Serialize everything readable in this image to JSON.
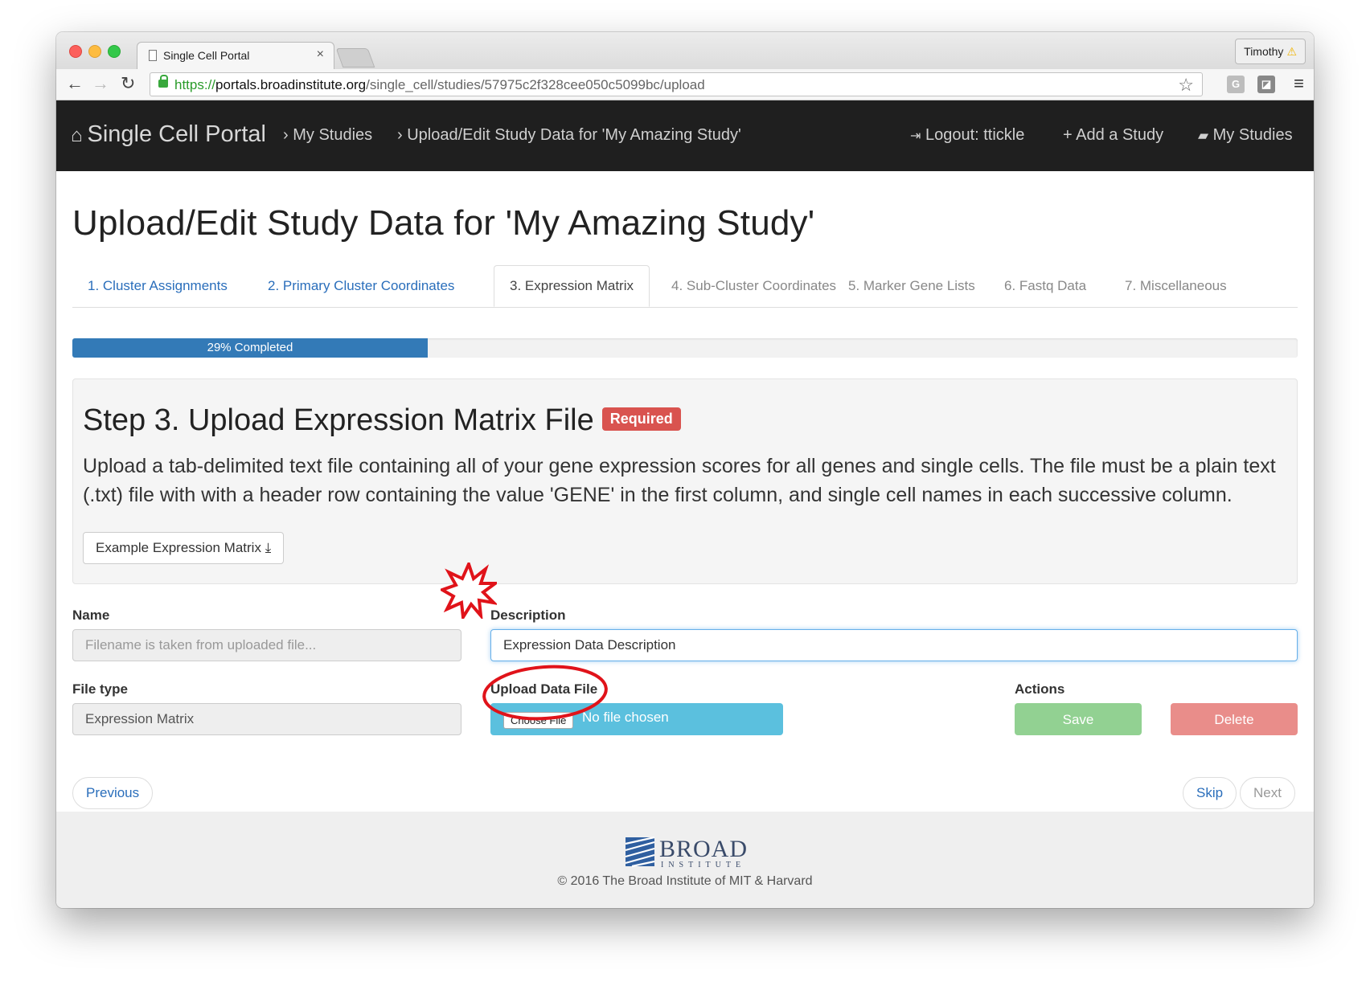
{
  "browser": {
    "tab_title": "Single Cell Portal",
    "tab_close": "×",
    "profile_name": "Timothy",
    "url_scheme": "https://",
    "url_domain": "portals.broadinstitute.org",
    "url_path": "/single_cell/studies/57975c2f328cee050c5099bc/upload"
  },
  "navbar": {
    "brand": "Single Cell Portal",
    "crumb_my_studies": "My Studies",
    "crumb_upload": "Upload/Edit Study Data for 'My Amazing Study'",
    "logout": "Logout: ttickle",
    "add_study": "Add a Study",
    "my_studies": "My Studies"
  },
  "page": {
    "title": "Upload/Edit Study Data for 'My Amazing Study'",
    "tabs": [
      {
        "label": "1. Cluster Assignments",
        "state": "link"
      },
      {
        "label": "2. Primary Cluster Coordinates",
        "state": "link"
      },
      {
        "label": "3. Expression Matrix",
        "state": "active"
      },
      {
        "label": "4. Sub-Cluster Coordinates",
        "state": "disabled"
      },
      {
        "label": "5. Marker Gene Lists",
        "state": "disabled"
      },
      {
        "label": "6. Fastq Data",
        "state": "disabled"
      },
      {
        "label": "7. Miscellaneous",
        "state": "disabled"
      }
    ],
    "progress_percent": 29,
    "progress_label": "29% Completed"
  },
  "step": {
    "heading": "Step 3. Upload Expression Matrix File",
    "badge": "Required",
    "description": "Upload a tab-delimited text file containing all of your gene expression scores for all genes and single cells. The file must be a plain text (.txt) file with with a header row containing the value 'GENE' in the first column, and single cell names in each successive column.",
    "example_button": "Example Expression Matrix"
  },
  "form": {
    "name_label": "Name",
    "name_placeholder": "Filename is taken from uploaded file...",
    "description_label": "Description",
    "description_value": "Expression Data Description",
    "filetype_label": "File type",
    "filetype_value": "Expression Matrix",
    "upload_label": "Upload Data File",
    "choose_file": "Choose File",
    "no_file": "No file chosen",
    "actions_label": "Actions",
    "save": "Save",
    "delete": "Delete"
  },
  "pager": {
    "previous": "Previous",
    "skip": "Skip",
    "next": "Next"
  },
  "footer": {
    "logo_word": "BROAD",
    "logo_sub": "INSTITUTE",
    "copyright": "© 2016 The Broad Institute of MIT & Harvard"
  },
  "colors": {
    "navbar_bg": "#1f1f1f",
    "progress": "#337ab7",
    "required": "#d9534f",
    "upload_bg": "#5bc0de",
    "save": "#92d192",
    "delete": "#e98d8a",
    "annotation": "#e0131a"
  }
}
